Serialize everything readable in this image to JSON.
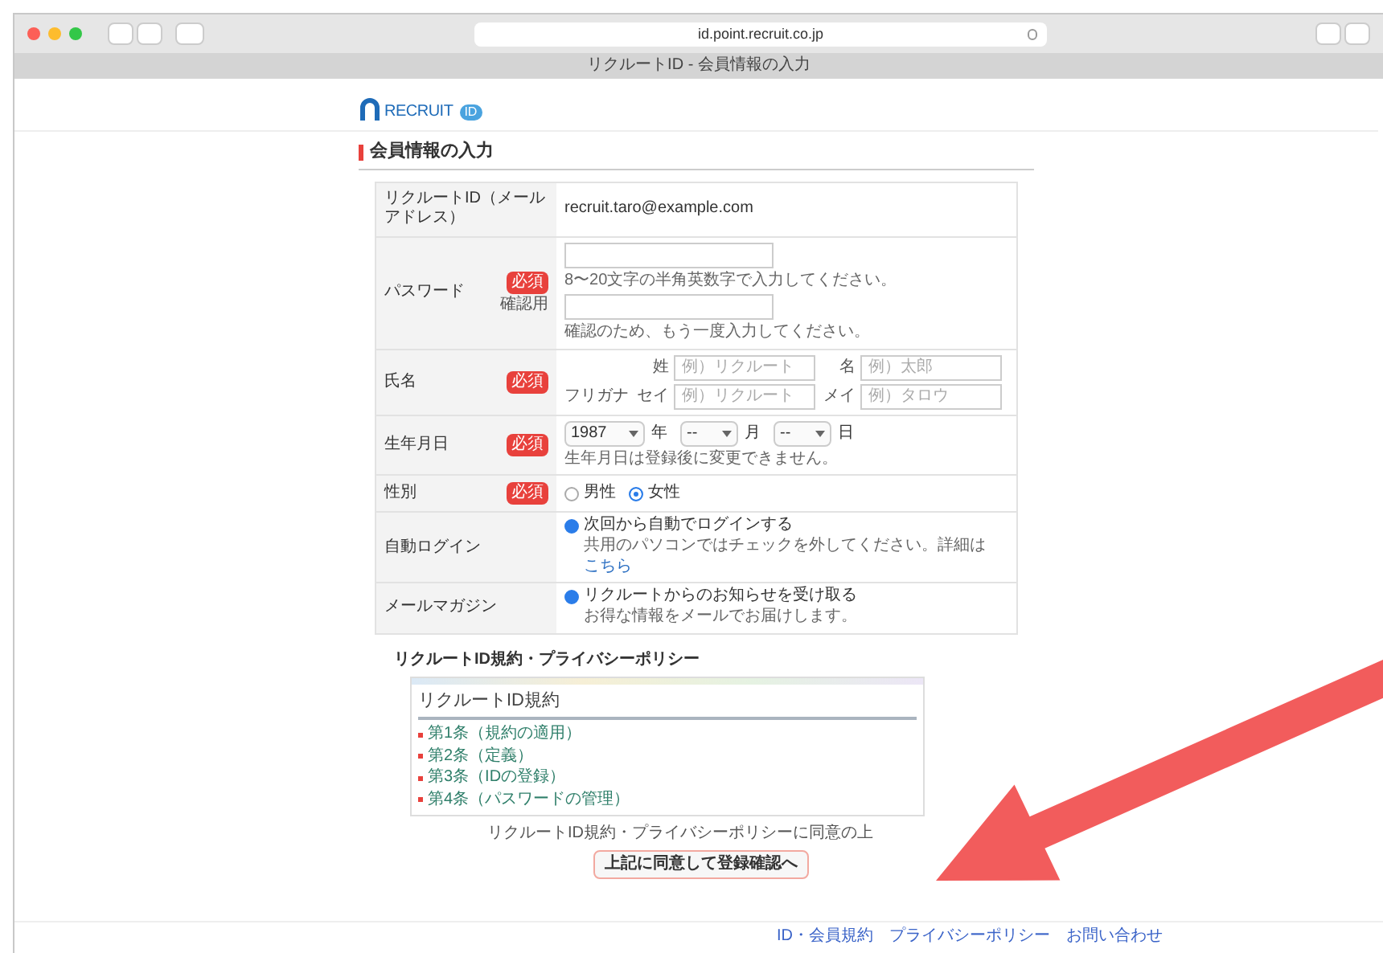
{
  "browser": {
    "url": "id.point.recruit.co.jp",
    "tab_title": "リクルートID - 会員情報の入力"
  },
  "logo": {
    "text": "RECRUIT",
    "badge": "ID"
  },
  "heading": "会員情報の入力",
  "form": {
    "rows": [
      {
        "kind": "static",
        "label": "リクルートID（メールアドレス）",
        "value": "recruit.taro@example.com"
      },
      {
        "kind": "password",
        "label": "パスワード",
        "badge": "必須",
        "sub_label": "確認用",
        "fields": [
          {
            "hint": "8〜20文字の半角英数字で入力してください。"
          },
          {
            "hint": "確認のため、もう一度入力してください。"
          }
        ]
      },
      {
        "kind": "name",
        "label": "氏名",
        "badge": "必須",
        "lines": [
          {
            "fields": [
              {
                "prefix": "姓",
                "placeholder": "例）リクルート"
              },
              {
                "prefix": "名",
                "placeholder": "例）太郎"
              }
            ]
          },
          {
            "sub_label": "フリガナ",
            "fields": [
              {
                "prefix": "セイ",
                "placeholder": "例）リクルート"
              },
              {
                "prefix": "メイ",
                "placeholder": "例）タロウ"
              }
            ]
          }
        ]
      },
      {
        "kind": "date",
        "label": "生年月日",
        "badge": "必須",
        "selects": [
          {
            "value": "1987",
            "unit": "年"
          },
          {
            "value": "--",
            "unit": "月"
          },
          {
            "value": "--",
            "unit": "日"
          }
        ],
        "hint": "生年月日は登録後に変更できません。"
      },
      {
        "kind": "radio",
        "label": "性別",
        "badge": "必須",
        "options": [
          {
            "label": "男性",
            "selected": false
          },
          {
            "label": "女性",
            "selected": true
          }
        ]
      },
      {
        "kind": "checkbox",
        "label": "自動ログイン",
        "checked": true,
        "option": "次回から自動でログインする",
        "description": "共用のパソコンではチェックを外してください。詳細は",
        "link": "こちら"
      },
      {
        "kind": "checkbox",
        "label": "メールマガジン",
        "checked": true,
        "option": "リクルートからのお知らせを受け取る",
        "description": "お得な情報をメールでお届けします。"
      }
    ]
  },
  "policy": {
    "title": "リクルートID規約・プライバシーポリシー",
    "box_title": "リクルートID規約",
    "items": [
      "第1条（規約の適用）",
      "第2条（定義）",
      "第3条（IDの登録）",
      "第4条（パスワードの管理）"
    ]
  },
  "consent": "リクルートID規約・プライバシーポリシーに同意の上",
  "submit": "上記に同意して登録確認へ",
  "footer_links": [
    "ID・会員規約",
    "プライバシーポリシー",
    "お問い合わせ"
  ]
}
